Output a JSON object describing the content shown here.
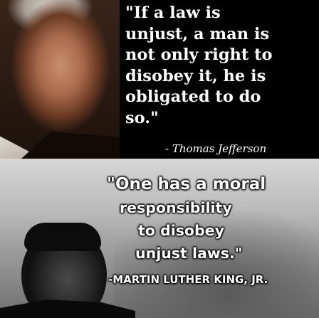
{
  "top_quote": {
    "lines": [
      "\"If a law is",
      "unjust, a man is",
      "not only right to",
      "disobey it, he is",
      "obligated to do",
      "so.\""
    ],
    "author": "- Thomas Jefferson"
  },
  "bottom_quote": {
    "lines": [
      "\"One has a moral",
      "responsibility",
      "to disobey",
      "unjust laws.\""
    ],
    "author": "-MARTIN LUTHER KING, JR."
  }
}
